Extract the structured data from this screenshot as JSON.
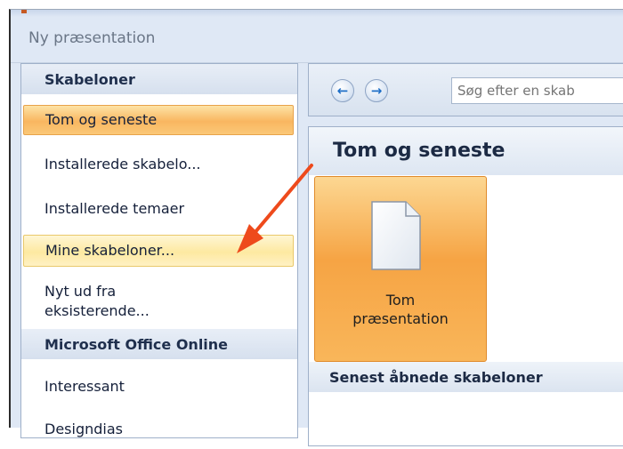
{
  "dialog": {
    "title": "Ny præsentation"
  },
  "sidebar": {
    "section_templates": "Skabeloner",
    "items": [
      {
        "label": "Tom og seneste"
      },
      {
        "label": "Installerede skabelo..."
      },
      {
        "label": "Installerede temaer"
      },
      {
        "label": "Mine skabeloner..."
      },
      {
        "label": "Nyt ud fra\neksisterende..."
      }
    ],
    "section_online": "Microsoft Office Online",
    "online_items": [
      {
        "label": "Interessant"
      },
      {
        "label": "Designdias"
      }
    ]
  },
  "navigation": {
    "back_icon": "back-arrow-icon",
    "forward_icon": "forward-arrow-icon",
    "search_placeholder": "Søg efter en skab"
  },
  "main": {
    "heading": "Tom og seneste",
    "tile": {
      "label": "Tom\npræsentation",
      "icon": "blank-document-icon"
    },
    "recent_header": "Senest åbnede skabeloner"
  },
  "annotation": {
    "arrow_color": "#ee4a1c"
  },
  "colors": {
    "selected": "#f9b660",
    "hover": "#fde9a1",
    "accent_blue": "#1f6fc7"
  }
}
